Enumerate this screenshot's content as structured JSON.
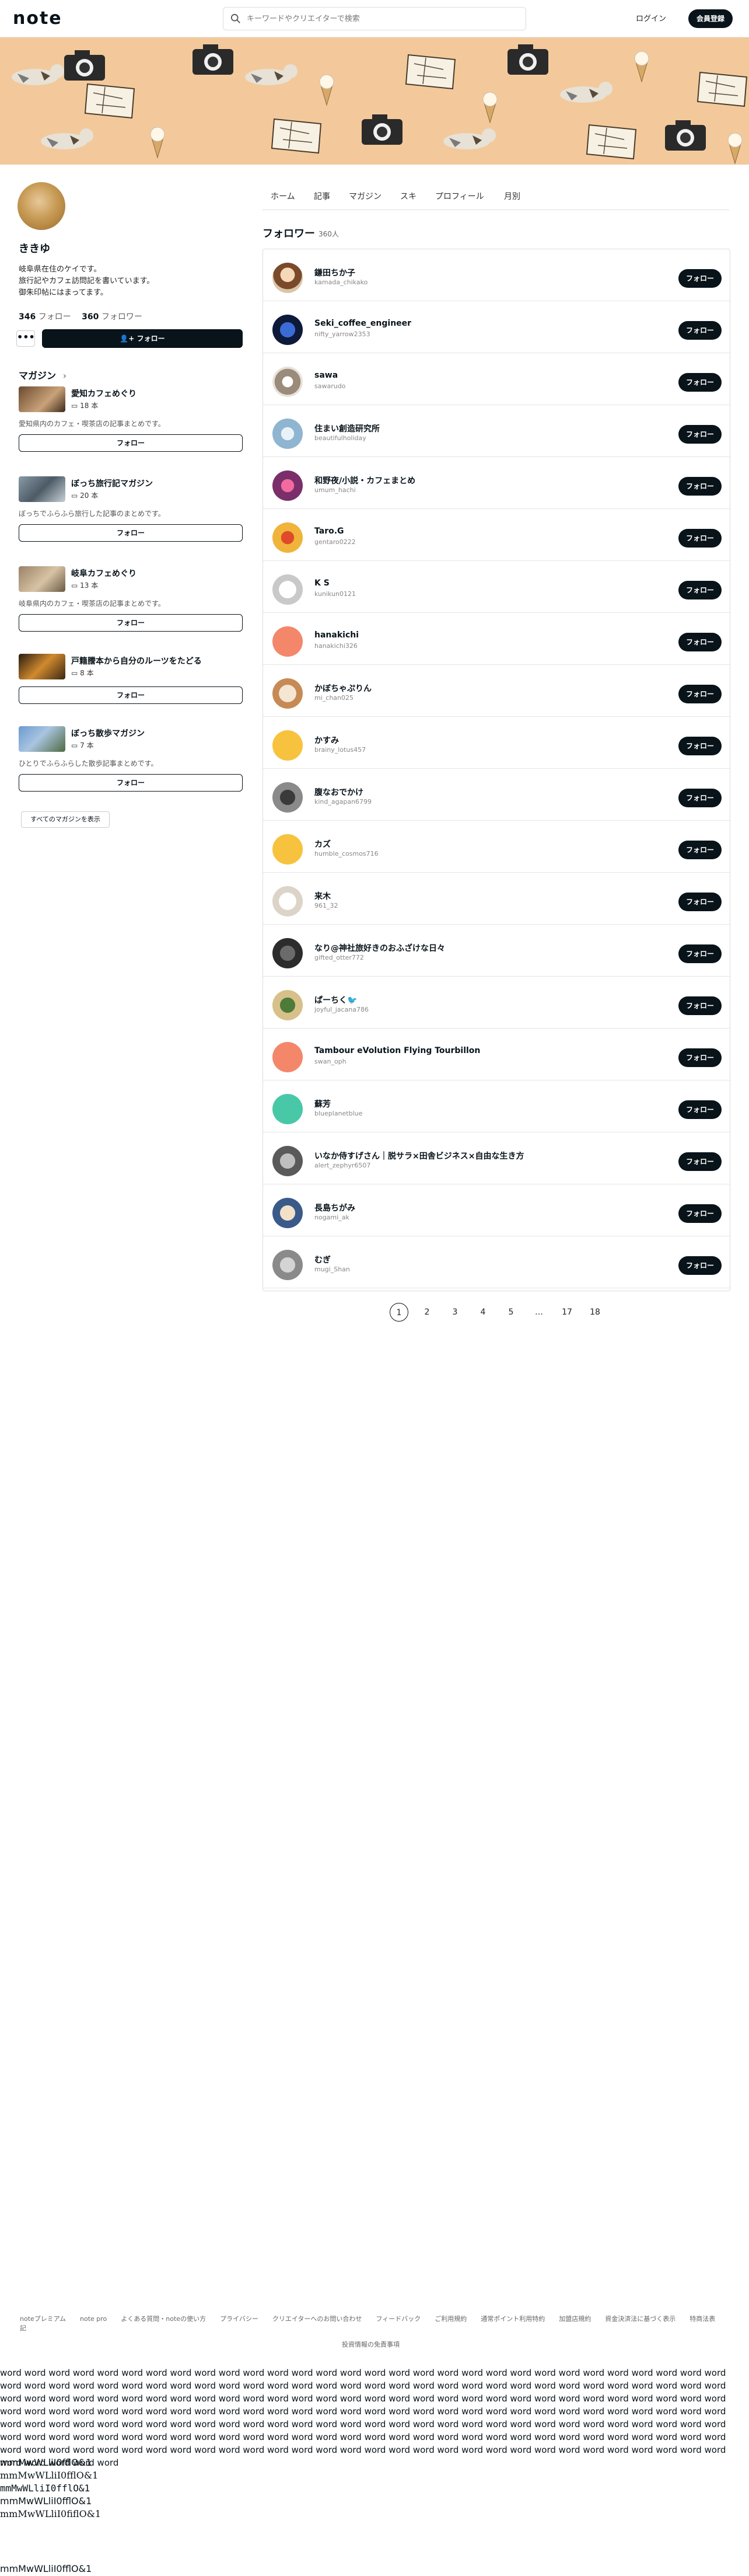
{
  "header": {
    "logo": "note",
    "search_placeholder": "キーワードやクリエイターで検索",
    "login": "ログイン",
    "signup": "会員登録"
  },
  "profile": {
    "name": "ききゆ",
    "bio": [
      "岐阜県在住のケイです。",
      "旅行記やカフェ訪問記を書いています。",
      "御朱印帖にはまってます。"
    ],
    "following_count": "346",
    "following_label": "フォロー",
    "followers_count": "360",
    "followers_label": "フォロワー",
    "more_label": "•••",
    "follow_label": "フォロー"
  },
  "magazines": {
    "heading": "マガジン",
    "items": [
      {
        "title": "愛知カフェめぐり",
        "count": "18 本",
        "desc": "愛知県内のカフェ・喫茶店の記事まとめです。",
        "button": "フォロー"
      },
      {
        "title": "ぼっち旅行記マガジン",
        "count": "20 本",
        "desc": "ぼっちでふらふら旅行した記事のまとめです。",
        "button": "フォロー"
      },
      {
        "title": "岐阜カフェめぐり",
        "count": "13 本",
        "desc": "岐阜県内のカフェ・喫茶店の記事まとめです。",
        "button": "フォロー"
      },
      {
        "title": "戸籍謄本から自分のルーツをたどる",
        "count": "8 本",
        "desc": "",
        "button": "フォロー"
      },
      {
        "title": "ぼっち散歩マガジン",
        "count": "7 本",
        "desc": "ひとりでふらふらした散歩記事まとめです。",
        "button": "フォロー"
      }
    ],
    "all_label": "すべてのマガジンを表示"
  },
  "tabs": [
    "ホーム",
    "記事",
    "マガジン",
    "スキ",
    "プロフィール",
    "月別"
  ],
  "followers_section": {
    "heading": "フォロワー",
    "count": "360人",
    "button_label": "フォロー",
    "rows": [
      {
        "name": "鎌田ちか子",
        "id": "kamada_chikako"
      },
      {
        "name": "Seki_coffee_engineer",
        "id": "nifty_yarrow2353"
      },
      {
        "name": "sawa",
        "id": "sawarudo"
      },
      {
        "name": "住まい創造研究所",
        "id": "beautifulholiday"
      },
      {
        "name": "和野夜/小説・カフェまとめ",
        "id": "umum_hachi"
      },
      {
        "name": "Taro.G",
        "id": "gentaro0222"
      },
      {
        "name": "K S",
        "id": "kunikun0121"
      },
      {
        "name": "hanakichi",
        "id": "hanakichi326"
      },
      {
        "name": "かぼちゃぷりん",
        "id": "mi_chan025"
      },
      {
        "name": "かすみ",
        "id": "brainy_lotus457"
      },
      {
        "name": "腹なおでかけ",
        "id": "kind_agapan6799"
      },
      {
        "name": "カズ",
        "id": "humble_cosmos716"
      },
      {
        "name": "来木",
        "id": "961_32"
      },
      {
        "name": "なり@神社旅好きのおふざけな日々",
        "id": "gifted_otter772"
      },
      {
        "name": "ぱーちく🐦",
        "id": "joyful_jacana786"
      },
      {
        "name": "Tambour eVolution Flying Tourbillon",
        "id": "swan_oph"
      },
      {
        "name": "蘇芳",
        "id": "blueplanetblue"
      },
      {
        "name": "いなか侍すげさん｜脱サラ×田舎ビジネス×自由な生き方",
        "id": "alert_zephyr6507"
      },
      {
        "name": "長島ちがみ",
        "id": "nogami_ak"
      },
      {
        "name": "むぎ",
        "id": "mugi_Shan"
      }
    ]
  },
  "pagination": [
    "1",
    "2",
    "3",
    "4",
    "5",
    "…",
    "17",
    "18"
  ],
  "footer": {
    "links": [
      "noteプレミアム",
      "note pro",
      "よくある質問・noteの使い方",
      "プライバシー",
      "クリエイターへのお問い合わせ",
      "フィードバック",
      "ご利用規約",
      "通常ポイント利用特約",
      "加盟店規約",
      "資金決済法に基づく表示",
      "特商法表記"
    ],
    "line2": "投資情報の免責事項"
  },
  "test_words": "word word word word word word word word word word word word word word word word word word word word word word word word word word word word word word word word word word word word word word word word word word word word word word word word word word word word word word word word word word word word word word word word word word word word word word word word word word word word word word word word word word word word word word word word word word word word word word word word word word word word word word word word word word word word word word word word word word word word word word word word word word word word word word word word word word word word word word word word word word word word word word word word word word word word word word word word word word word word word word word word word word word word word word word word word word word word word word word word word word word word word word word word word word word word word word word word word word word word word word word word word word word word word word word word word word word word word word word",
  "test_strings": [
    "mmMwWLliI0fflO&1",
    "mmMwWLliI0fflO&1",
    "mmMwWLliI0fflO&1",
    "mmMwWLliI0fflO&1",
    "mmMwWLliI0fiflO&1",
    "mmMwWLliI0fflO&1"
  ],
  "colors": {
    "accent": "#08131a",
    "banner": "#f3c99b"
  }
}
